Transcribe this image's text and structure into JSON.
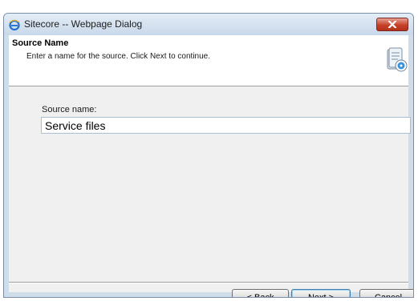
{
  "window": {
    "title": "Sitecore -- Webpage Dialog",
    "app_icon": "internet-explorer-icon",
    "close_icon": "close-icon"
  },
  "header": {
    "title": "Source Name",
    "description": "Enter a name for the source. Click Next to continue.",
    "icon": "source-wizard-icon"
  },
  "form": {
    "label": "Source name:",
    "value": "Service files"
  },
  "buttons": {
    "back": "< Back",
    "next": "Next >",
    "cancel": "Cancel"
  },
  "colors": {
    "accent": "#3c7fb1",
    "close_button": "#c8412b",
    "content_background": "#f0f0f0",
    "header_background": "#ffffff"
  }
}
